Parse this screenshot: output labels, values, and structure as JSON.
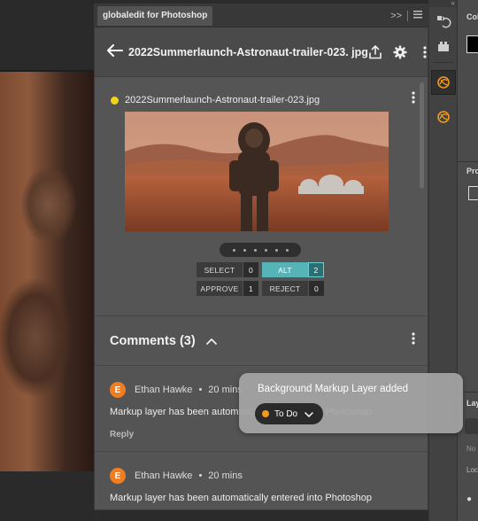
{
  "plugin": {
    "tab_title": "globaledit for Photoshop",
    "tab_more": ">>"
  },
  "header": {
    "title": "2022Summerlaunch-Astronaut-trailer-023. jpg"
  },
  "asset": {
    "name": "2022Summerlaunch-Astronaut-trailer-023.jpg",
    "status_color": "#f2d21b",
    "pager_dots": 6,
    "votes": [
      {
        "label": "SELECT",
        "count": "0",
        "active": false
      },
      {
        "label": "ALT",
        "count": "2",
        "active": true
      },
      {
        "label": "APPROVE",
        "count": "1",
        "active": false
      },
      {
        "label": "REJECT",
        "count": "0",
        "active": false
      }
    ]
  },
  "comments": {
    "title": "Comments (3)",
    "items": [
      {
        "initial": "E",
        "author": "Ethan Hawke",
        "sep": "•",
        "time": "20 mins",
        "text": "Markup layer has been automatically entered into Photoshop",
        "reply": "Reply"
      },
      {
        "initial": "E",
        "author": "Ethan Hawke",
        "sep": "•",
        "time": "20 mins",
        "text": "Markup layer has been automatically entered into Photoshop"
      }
    ]
  },
  "toast": {
    "title": "Background Markup Layer added",
    "status_label": "To Do",
    "status_color": "#f39a1c"
  },
  "far_panels": {
    "top_label": "Col",
    "mid_label": "Pro",
    "layers_label": "Lay",
    "no_label": "No",
    "lock_label": "Lock"
  },
  "colors": {
    "accent_teal": "#56b4b7",
    "avatar_orange": "#ef7d22"
  }
}
